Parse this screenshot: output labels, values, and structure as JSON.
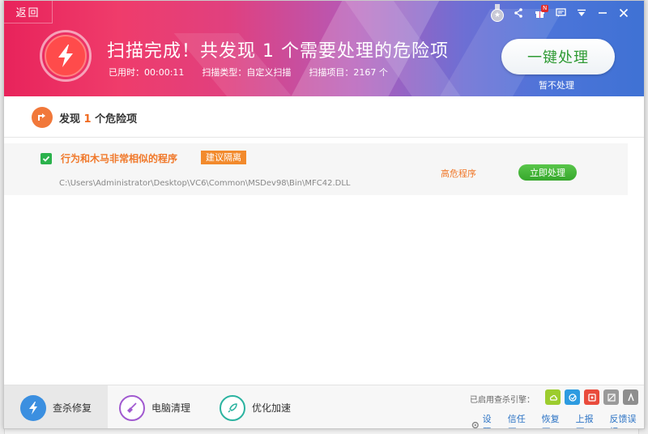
{
  "header": {
    "back_label": "返回",
    "scan_title": "扫描完成！共发现  1  个需要处理的危险项",
    "elapsed": "已用时：00:00:11",
    "scan_type": "扫描类型：自定义扫描",
    "scan_items": "扫描项目：2167 个",
    "one_key_label": "一键处理",
    "skip_label": "暂不处理",
    "badge": "N"
  },
  "content": {
    "found_prefix": "发现",
    "found_count": "1",
    "found_suffix": "个危险项",
    "item": {
      "name": "行为和木马非常相似的程序",
      "tag": "建议隔离",
      "path": "C:\\Users\\Administrator\\Desktop\\VC6\\Common\\MSDev98\\Bin\\MFC42.DLL",
      "level": "高危程序",
      "action": "立即处理"
    }
  },
  "footer": {
    "tabs": [
      {
        "label": "查杀修复"
      },
      {
        "label": "电脑清理"
      },
      {
        "label": "优化加速"
      }
    ],
    "engine_label": "已启用查杀引擎：",
    "links": [
      "设置",
      "信任区",
      "恢复区",
      "上报区",
      "反馈误报"
    ]
  },
  "colors": {
    "accent_green": "#36a72c",
    "risk_orange": "#f0782a",
    "link_blue": "#2a72c4"
  }
}
